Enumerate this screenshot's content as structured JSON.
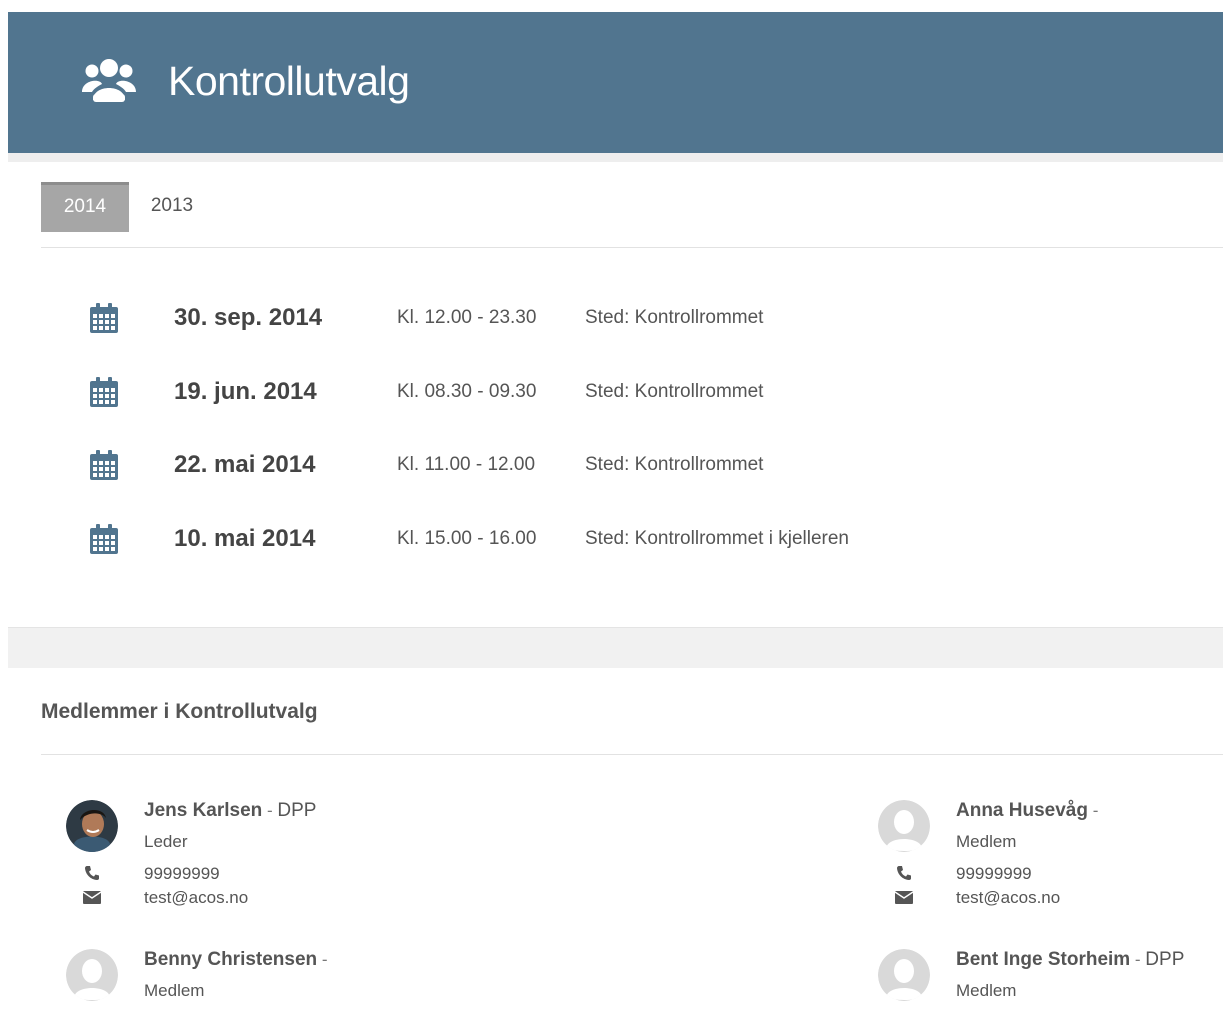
{
  "header": {
    "title": "Kontrollutvalg",
    "icon": "users-icon",
    "background_color": "#51758f"
  },
  "tabs": [
    {
      "label": "2014",
      "active": true
    },
    {
      "label": "2013",
      "active": false
    }
  ],
  "meetings": [
    {
      "date": "30. sep. 2014",
      "time": "Kl. 12.00 - 23.30",
      "place": "Sted: Kontrollrommet"
    },
    {
      "date": "19. jun. 2014",
      "time": "Kl. 08.30 - 09.30",
      "place": "Sted: Kontrollrommet"
    },
    {
      "date": "22. mai 2014",
      "time": "Kl. 11.00 - 12.00",
      "place": "Sted: Kontrollrommet"
    },
    {
      "date": "10. mai 2014",
      "time": "Kl. 15.00 - 16.00",
      "place": "Sted: Kontrollrommet i kjelleren"
    }
  ],
  "members_section": {
    "title": "Medlemmer i Kontrollutvalg"
  },
  "members": [
    {
      "name": "Jens Karlsen",
      "party": "DPP",
      "role": "Leder",
      "phone": "99999999",
      "email": "test@acos.no",
      "has_photo": true
    },
    {
      "name": "Anna Husevåg",
      "party": "",
      "role": "Medlem",
      "phone": "99999999",
      "email": "test@acos.no",
      "has_photo": false
    },
    {
      "name": "Benny Christensen",
      "party": "",
      "role": "Medlem",
      "has_photo": false
    },
    {
      "name": "Bent Inge Storheim",
      "party": "DPP",
      "role": "Medlem",
      "has_photo": false
    }
  ],
  "colors": {
    "accent": "#51758f",
    "tab_active": "#a6a6a6",
    "calendar_icon": "#51758f"
  }
}
